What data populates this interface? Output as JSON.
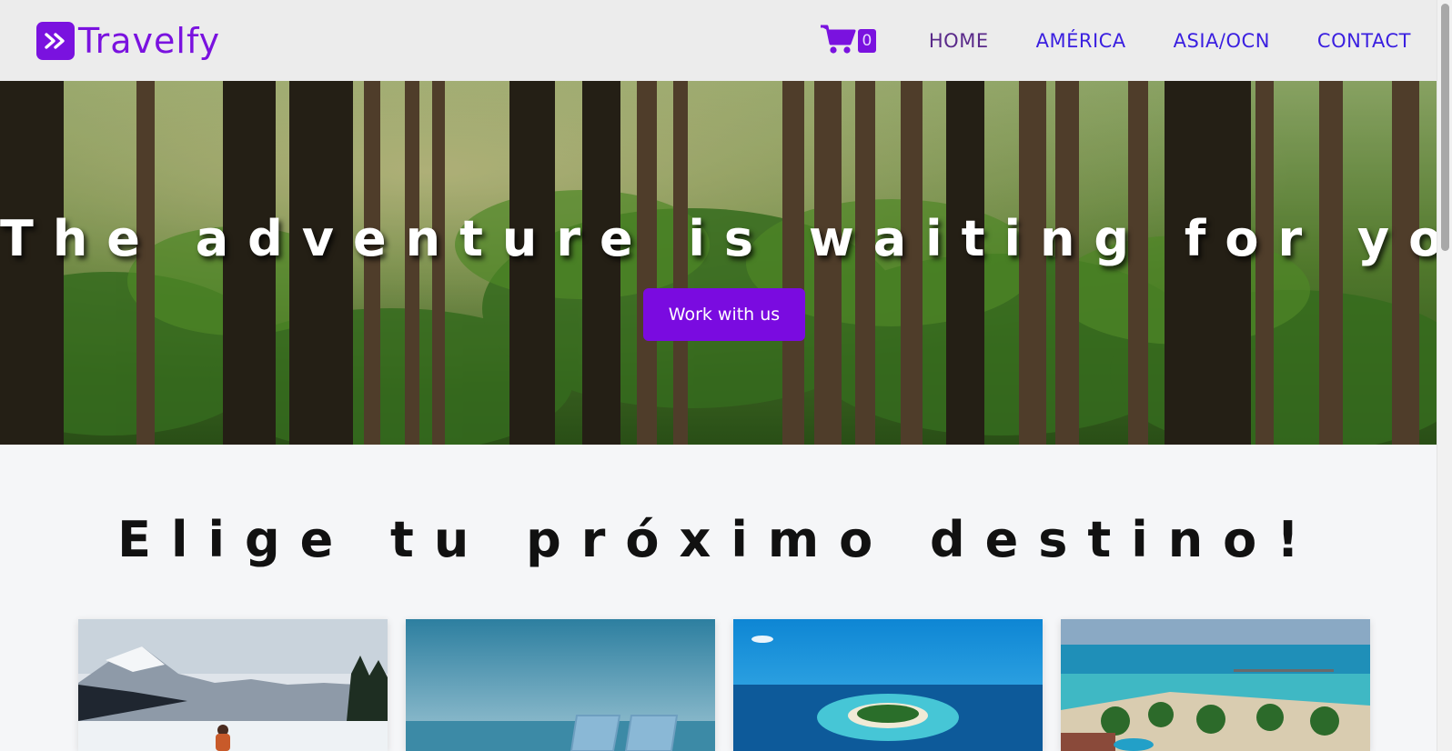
{
  "brand": {
    "name": "Travelfy",
    "logo_icon": "double-chevron-right-icon"
  },
  "cart": {
    "icon": "cart-icon",
    "count": "0"
  },
  "nav": {
    "items": [
      {
        "label": "HOME",
        "active": true
      },
      {
        "label": "AMÉRICA",
        "active": false
      },
      {
        "label": "ASIA/OCN",
        "active": false
      },
      {
        "label": "CONTACT",
        "active": false
      }
    ]
  },
  "hero": {
    "title": "The adventure is waiting for you",
    "button_label": "Work with us"
  },
  "destinations": {
    "title": "Elige tu próximo destino!",
    "cards": [
      {
        "name": "destination-card-snow-mountains"
      },
      {
        "name": "destination-card-beach-chairs"
      },
      {
        "name": "destination-card-atoll-island"
      },
      {
        "name": "destination-card-resort-beach"
      }
    ]
  },
  "colors": {
    "brand": "#7a12df",
    "nav_link": "#3a1fe0",
    "nav_active": "#5a2a8a",
    "header_bg": "#ececec",
    "page_bg": "#f5f6f8"
  }
}
